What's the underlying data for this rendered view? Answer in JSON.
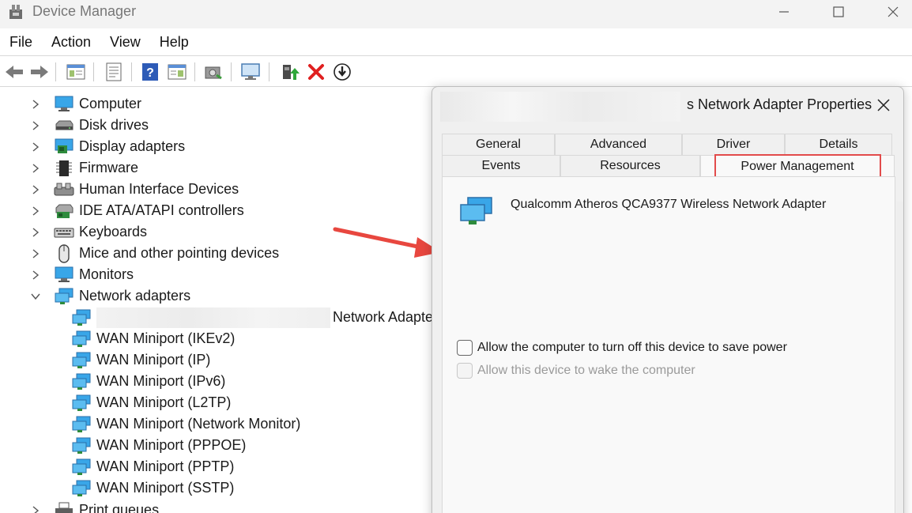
{
  "window": {
    "title": "Device Manager"
  },
  "menu": [
    {
      "label": "File"
    },
    {
      "label": "Action"
    },
    {
      "label": "View"
    },
    {
      "label": "Help"
    }
  ],
  "toolbar_icons": [
    "back-icon",
    "forward-icon",
    "show-hide-tree-icon",
    "properties-icon",
    "help-icon",
    "details-view-icon",
    "scan-hardware-icon",
    "monitor-icon",
    "update-driver-icon",
    "uninstall-device-icon",
    "disable-device-icon"
  ],
  "tree": {
    "categories_top": [
      {
        "label": "Computer",
        "icon": "computer-icon"
      },
      {
        "label": "Disk drives",
        "icon": "disk-drive-icon"
      },
      {
        "label": "Display adapters",
        "icon": "display-adapter-icon"
      },
      {
        "label": "Firmware",
        "icon": "firmware-icon"
      },
      {
        "label": "Human Interface Devices",
        "icon": "hid-icon"
      },
      {
        "label": "IDE ATA/ATAPI controllers",
        "icon": "ide-controller-icon"
      },
      {
        "label": "Keyboards",
        "icon": "keyboard-icon"
      },
      {
        "label": "Mice and other pointing devices",
        "icon": "mouse-icon"
      },
      {
        "label": "Monitors",
        "icon": "monitor-icon"
      }
    ],
    "network_adapters": {
      "label": "Network adapters",
      "children": [
        {
          "label": "Network Adapte"
        },
        {
          "label": "WAN Miniport (IKEv2)"
        },
        {
          "label": "WAN Miniport (IP)"
        },
        {
          "label": "WAN Miniport (IPv6)"
        },
        {
          "label": "WAN Miniport (L2TP)"
        },
        {
          "label": "WAN Miniport (Network Monitor)"
        },
        {
          "label": "WAN Miniport (PPPOE)"
        },
        {
          "label": "WAN Miniport (PPTP)"
        },
        {
          "label": "WAN Miniport (SSTP)"
        }
      ]
    },
    "categories_bottom": [
      {
        "label": "Print queues",
        "icon": "printer-icon"
      }
    ]
  },
  "dialog": {
    "title": "s Network Adapter Properties",
    "tabs_row1": [
      {
        "label": "General"
      },
      {
        "label": "Advanced"
      },
      {
        "label": "Driver"
      },
      {
        "label": "Details"
      }
    ],
    "tabs_row2": [
      {
        "label": "Events"
      },
      {
        "label": "Resources"
      },
      {
        "label": "Power Management"
      }
    ],
    "active_tab": "Power Management",
    "device_name": "Qualcomm Atheros QCA9377 Wireless Network Adapter",
    "options": [
      {
        "label": "Allow the computer to turn off this device to save power",
        "checked": false,
        "enabled": true
      },
      {
        "label": "Allow this device to wake the computer",
        "checked": false,
        "enabled": false
      }
    ]
  },
  "annotation": {
    "color": "#e8473f"
  }
}
